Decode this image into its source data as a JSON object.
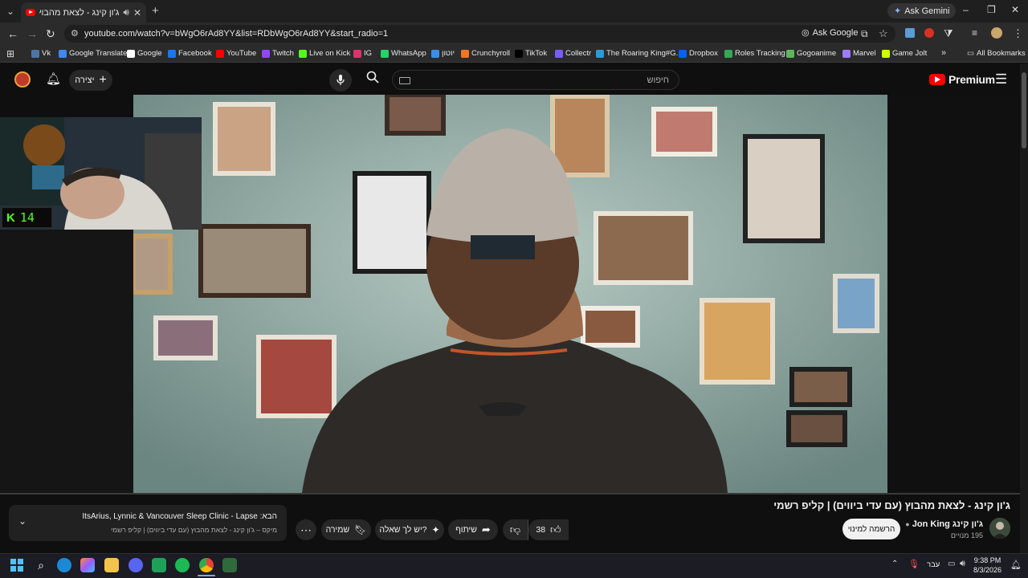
{
  "browser": {
    "tab_title": "ג'ון קינג - לצאת מהבוץ (עם",
    "ask_gemini": "Ask Gemini",
    "url": "youtube.com/watch?v=bWgO6rAd8YY&list=RDbWgO6rAd8YY&start_radio=1",
    "ask_google": "Ask Google"
  },
  "bookmarks": [
    {
      "label": "Vk",
      "color": "#4c75a3"
    },
    {
      "label": "Google Translate",
      "color": "#4285f4"
    },
    {
      "label": "Google",
      "color": "#ffffff"
    },
    {
      "label": "Facebook",
      "color": "#1877f2"
    },
    {
      "label": "YouTube",
      "color": "#ff0000"
    },
    {
      "label": "Twitch",
      "color": "#9146ff"
    },
    {
      "label": "Live on Kick",
      "color": "#53fc18"
    },
    {
      "label": "IG",
      "color": "#e1306c"
    },
    {
      "label": "WhatsApp",
      "color": "#25d366"
    },
    {
      "label": "יוטון",
      "color": "#3a8ee6"
    },
    {
      "label": "Crunchyroll",
      "color": "#f47521"
    },
    {
      "label": "TikTok",
      "color": "#000000"
    },
    {
      "label": "Collectr",
      "color": "#7b5cff"
    },
    {
      "label": "The Roaring King#G...",
      "color": "#2b9bd6"
    },
    {
      "label": "Dropbox",
      "color": "#0061ff"
    },
    {
      "label": "Roles Tracking",
      "color": "#34a853"
    },
    {
      "label": "Gogoanime",
      "color": "#5cb85c"
    },
    {
      "label": "Marvel",
      "color": "#9c7cff"
    },
    {
      "label": "Game Jolt",
      "color": "#ccff00"
    }
  ],
  "all_bookmarks": "All Bookmarks",
  "youtube": {
    "create_label": "יצירה",
    "search_placeholder": "חיפוש",
    "logo_text": "Premium",
    "video_title": "ג'ון קינג - לצאת מהבוץ (עם עדי ביווים) | קליפ רשמי",
    "channel_name": "ג'ון קינג Jon King",
    "subscribers": "195 מנויים",
    "subscribe_label": "הרשמה למינוי",
    "like_count": "38",
    "share_label": "שיתוף",
    "ask_label": "יש לך שאלה?",
    "save_label": "שמירה",
    "queue_next": "הבא: ItsArius, Lynnic & Vancouver Sleep Clinic - Lapse",
    "queue_mix": "מיקס – ג'ון קינג - לצאת מהבוץ (עם עדי ביווים) | קליפ רשמי"
  },
  "stream_overlay": {
    "viewer_count": "14"
  },
  "taskbar": {
    "language": "עבר",
    "time": "9:38 PM",
    "date": "8/3/2026"
  }
}
